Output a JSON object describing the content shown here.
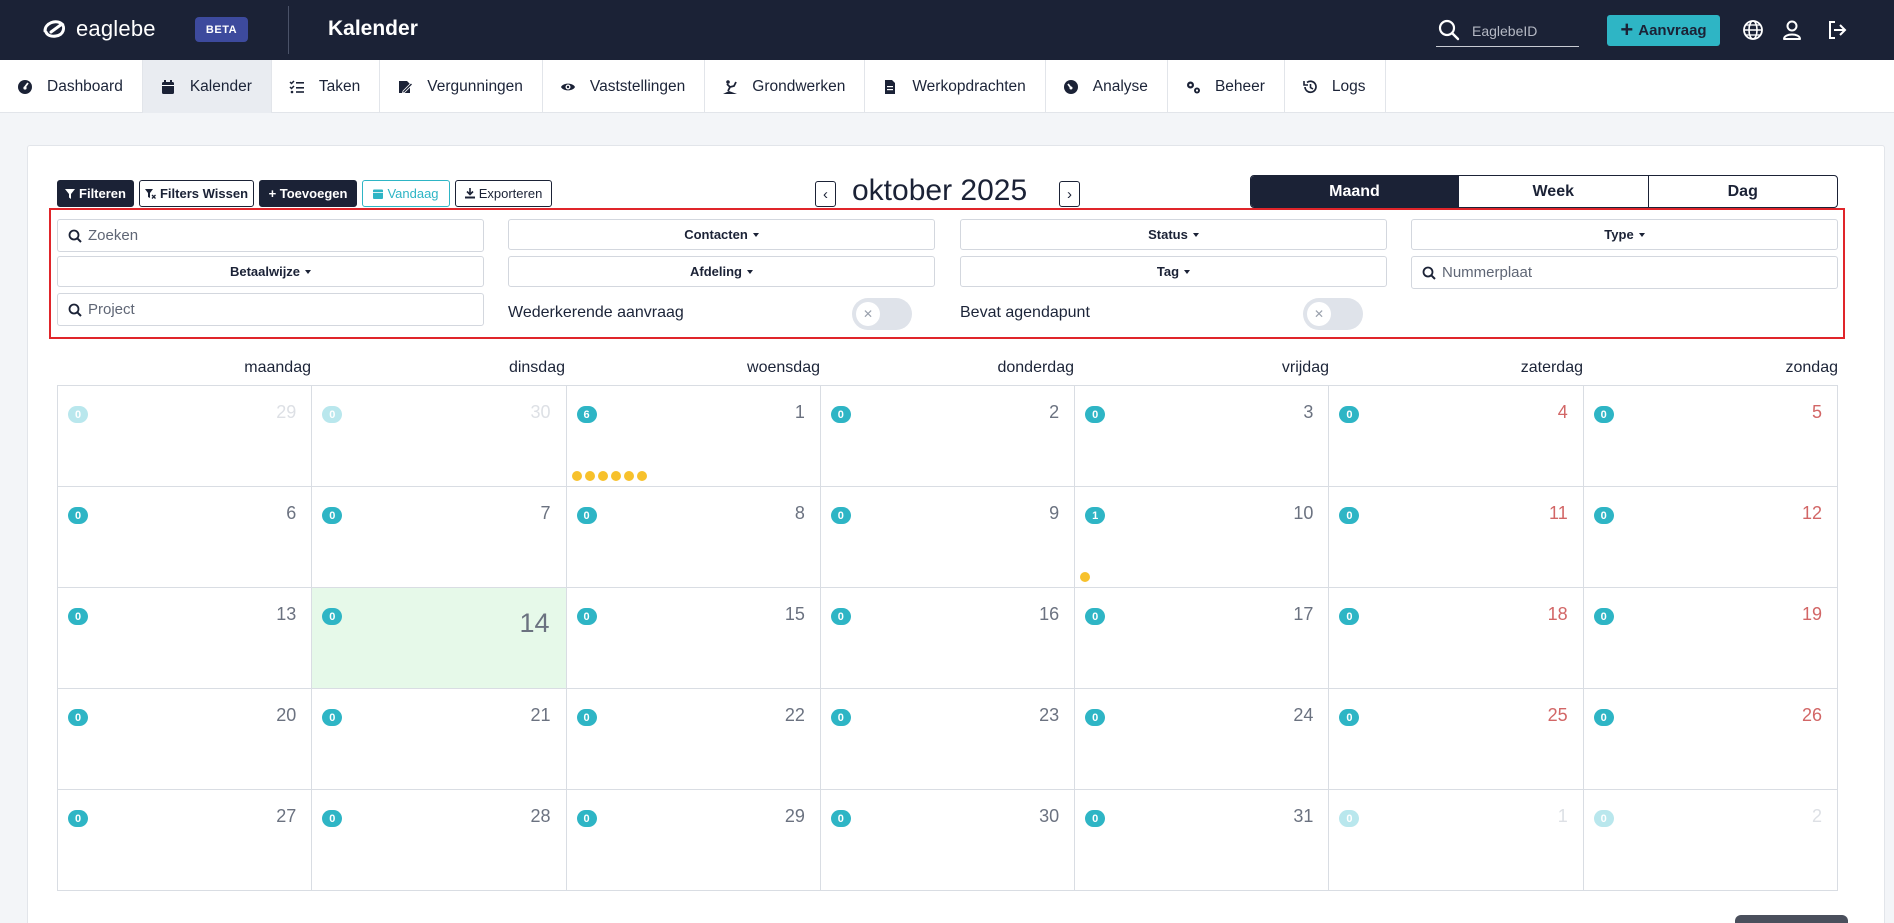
{
  "topbar": {
    "logo_text": "eaglebe",
    "beta_label": "BETA",
    "page_title": "Kalender",
    "search_placeholder": "EaglebeID",
    "new_request_label": "Aanvraag"
  },
  "nav": {
    "items": [
      {
        "label": "Dashboard",
        "icon": "dashboard-icon"
      },
      {
        "label": "Kalender",
        "icon": "calendar-icon",
        "active": true
      },
      {
        "label": "Taken",
        "icon": "tasks-icon"
      },
      {
        "label": "Vergunningen",
        "icon": "permit-icon"
      },
      {
        "label": "Vaststellingen",
        "icon": "eye-icon"
      },
      {
        "label": "Grondwerken",
        "icon": "digging-icon"
      },
      {
        "label": "Werkopdrachten",
        "icon": "document-icon"
      },
      {
        "label": "Analyse",
        "icon": "gauge-icon"
      },
      {
        "label": "Beheer",
        "icon": "cogs-icon"
      },
      {
        "label": "Logs",
        "icon": "history-icon"
      }
    ]
  },
  "toolbar": {
    "filter_label": "Filteren",
    "clear_filters_label": "Filters Wissen",
    "add_label": "+ Toevoegen",
    "today_label": "Vandaag",
    "export_label": "Exporteren"
  },
  "month_title": "oktober 2025",
  "views": {
    "month": "Maand",
    "week": "Week",
    "day": "Dag",
    "active": "Maand"
  },
  "filters": {
    "search_placeholder": "Zoeken",
    "contacts": "Contacten",
    "status": "Status",
    "type": "Type",
    "payment": "Betaalwijze",
    "department": "Afdeling",
    "tag": "Tag",
    "plate_placeholder": "Nummerplaat",
    "project_placeholder": "Project",
    "recurring_label": "Wederkerende aanvraag",
    "recurring_on": false,
    "agenda_label": "Bevat agendapunt",
    "agenda_on": false
  },
  "weekdays": [
    "maandag",
    "dinsdag",
    "woensdag",
    "donderdag",
    "vrijdag",
    "zaterdag",
    "zondag"
  ],
  "calendar": {
    "weeks": [
      [
        {
          "day": "29",
          "count": "0",
          "outside": true
        },
        {
          "day": "30",
          "count": "0",
          "outside": true
        },
        {
          "day": "1",
          "count": "6",
          "dots": 6
        },
        {
          "day": "2",
          "count": "0"
        },
        {
          "day": "3",
          "count": "0"
        },
        {
          "day": "4",
          "count": "0",
          "weekend": true
        },
        {
          "day": "5",
          "count": "0",
          "weekend": true
        }
      ],
      [
        {
          "day": "6",
          "count": "0"
        },
        {
          "day": "7",
          "count": "0"
        },
        {
          "day": "8",
          "count": "0"
        },
        {
          "day": "9",
          "count": "0"
        },
        {
          "day": "10",
          "count": "1",
          "dots": 1
        },
        {
          "day": "11",
          "count": "0",
          "weekend": true
        },
        {
          "day": "12",
          "count": "0",
          "weekend": true
        }
      ],
      [
        {
          "day": "13",
          "count": "0"
        },
        {
          "day": "14",
          "count": "0",
          "today": true
        },
        {
          "day": "15",
          "count": "0"
        },
        {
          "day": "16",
          "count": "0"
        },
        {
          "day": "17",
          "count": "0"
        },
        {
          "day": "18",
          "count": "0",
          "weekend": true
        },
        {
          "day": "19",
          "count": "0",
          "weekend": true
        }
      ],
      [
        {
          "day": "20",
          "count": "0"
        },
        {
          "day": "21",
          "count": "0"
        },
        {
          "day": "22",
          "count": "0"
        },
        {
          "day": "23",
          "count": "0"
        },
        {
          "day": "24",
          "count": "0"
        },
        {
          "day": "25",
          "count": "0",
          "weekend": true
        },
        {
          "day": "26",
          "count": "0",
          "weekend": true
        }
      ],
      [
        {
          "day": "27",
          "count": "0"
        },
        {
          "day": "28",
          "count": "0"
        },
        {
          "day": "29",
          "count": "0"
        },
        {
          "day": "30",
          "count": "0"
        },
        {
          "day": "31",
          "count": "0"
        },
        {
          "day": "1",
          "count": "0",
          "outside": true
        },
        {
          "day": "2",
          "count": "0",
          "outside": true
        }
      ]
    ]
  },
  "colors": {
    "topbar_bg": "#1b2236",
    "accent": "#2eb5c5",
    "today_bg": "#e6f9e9",
    "event_dot": "#f7c12c",
    "weekend_text": "#d26666",
    "filter_outline": "#e0252a"
  }
}
